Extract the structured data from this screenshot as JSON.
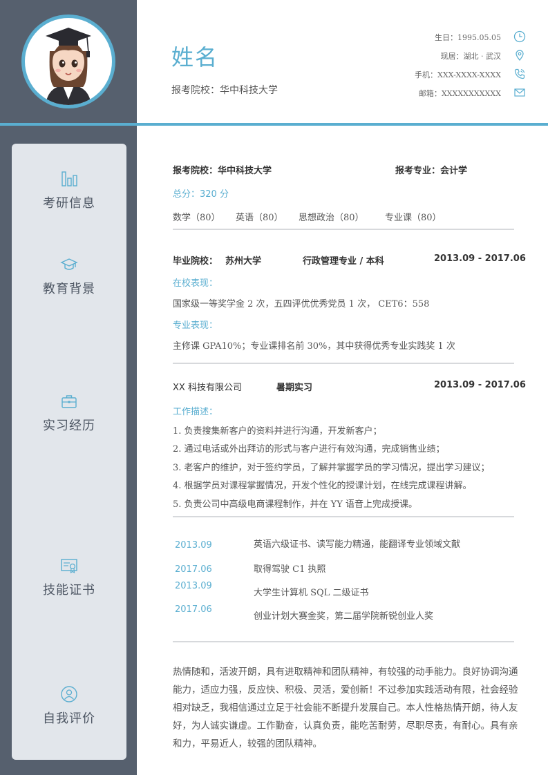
{
  "header": {
    "name": "姓名",
    "school": "报考院校：华中科技大学",
    "contacts": [
      {
        "icon": "clock-icon",
        "text": "生日：1995.05.05"
      },
      {
        "icon": "location-icon",
        "text": "现居：湖北 · 武汉"
      },
      {
        "icon": "phone-icon",
        "text": "手机：XXX-XXXX-XXXX"
      },
      {
        "icon": "mail-icon",
        "text": "邮箱：XXXXXXXXXXX"
      }
    ]
  },
  "sidebar": {
    "items": [
      {
        "icon": "bar-chart-icon",
        "label": "考研信息"
      },
      {
        "icon": "graduation-cap-icon",
        "label": "教育背景"
      },
      {
        "icon": "briefcase-icon",
        "label": "实习经历"
      },
      {
        "icon": "certificate-icon",
        "label": "技能证书"
      },
      {
        "icon": "person-icon",
        "label": "自我评价"
      }
    ]
  },
  "exam": {
    "school": "报考院校：华中科技大学",
    "major": "报考专业：会计学",
    "total": "总分：320 分",
    "subjects": [
      "数学（80）",
      "英语（80）",
      "思想政治（80）",
      "专业课（80）"
    ]
  },
  "education": {
    "school_label": "毕业院校：",
    "school": "苏州大学",
    "major": "行政管理专业 / 本科",
    "period": "2013.09 - 2017.06",
    "perf_title": "在校表现：",
    "perf": "国家级一等奖学金 2 次，五四评优优秀党员 1 次， CET6：558",
    "major_title": "专业表现：",
    "major_perf": "主修课 GPA10%；专业课排名前 30%，其中获得优秀专业实践奖 1 次"
  },
  "internship": {
    "company": "XX 科技有限公司",
    "type": "暑期实习",
    "period": "2013.09 - 2017.06",
    "desc_title": "工作描述：",
    "items": [
      "1.  负责搜集新客户的资料并进行沟通，开发新客户；",
      "2.  通过电话或外出拜访的形式与客户进行有效沟通，完成销售业绩；",
      "3.  老客户的维护，对于签约学员，了解并掌握学员的学习情况，提出学习建议；",
      "4.  根据学员对课程掌握情况，开发个性化的授课计划，在线完成课程讲解。",
      "5.  负责公司中高级电商课程制作，并在 YY 语音上完成授课。"
    ]
  },
  "certificates": [
    {
      "date": "2013.09",
      "text": "英语六级证书、读写能力精通，能翻译专业领域文献"
    },
    {
      "date": "2017.06",
      "text": "取得驾驶 C1 执照"
    },
    {
      "date": "2013.09",
      "text": "大学生计算机 SQL 二级证书"
    },
    {
      "date": "2017.06",
      "text": "创业计划大赛金奖，第二届学院新锐创业人奖"
    }
  ],
  "self_eval": "热情随和，活波开朗，具有进取精神和团队精神，有较强的动手能力。良好协调沟通能力，适应力强，反应快、积极、灵活，爱创新！不过参加实践活动有限，社会经验相对缺乏，我相信通过立足于社会能不断提升发展自己。本人性格热情开朗，待人友好，为人诚实谦虚。工作勤奋，认真负责，能吃苦耐劳，尽职尽责，有耐心。具有亲和力，平易近人，较强的团队精神。",
  "colors": {
    "accent": "#5aaed0",
    "sidebar": "#56606e",
    "panel": "#e2e6eb"
  }
}
